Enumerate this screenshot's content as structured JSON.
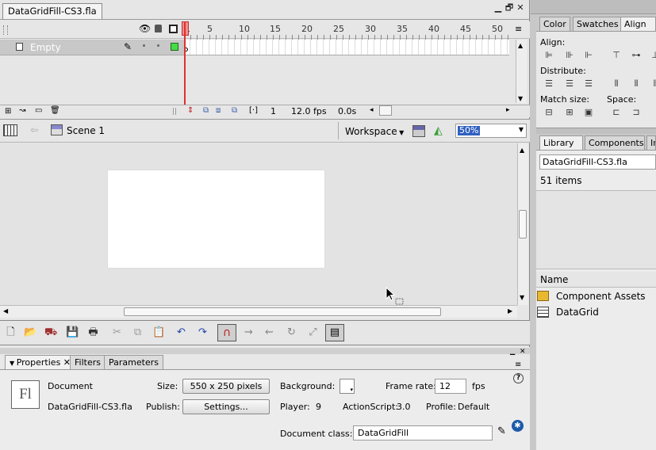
{
  "document_tab": {
    "label": "DataGridFill-CS3.fla"
  },
  "window_controls": {
    "minimize": "▁",
    "restore": "🗗",
    "close": "✕"
  },
  "timeline": {
    "ruler": [
      "1",
      "5",
      "10",
      "15",
      "20",
      "25",
      "30",
      "35",
      "40",
      "45",
      "50"
    ],
    "layer": {
      "name": "Empty"
    },
    "status": {
      "frame": "1",
      "fps": "12.0 fps",
      "time": "0.0s"
    }
  },
  "scene_bar": {
    "scene_label": "Scene 1",
    "workspace_label": "Workspace",
    "zoom_value": "50%"
  },
  "properties": {
    "tabs": [
      "Properties",
      "Filters",
      "Parameters"
    ],
    "type_label": "Document",
    "file_name": "DataGridFill-CS3.fla",
    "logo_text": "Fl",
    "size_label": "Size:",
    "size_value": "550 x 250 pixels",
    "publish_label": "Publish:",
    "settings_button": "Settings...",
    "background_label": "Background:",
    "frame_rate_label": "Frame rate:",
    "frame_rate_value": "12",
    "fps_unit": "fps",
    "player_label": "Player:",
    "player_value": "9",
    "actionscript_label": "ActionScript:",
    "actionscript_value": "3.0",
    "profile_label": "Profile:",
    "profile_value": "Default",
    "doc_class_label": "Document class:",
    "doc_class_value": "DataGridFill",
    "help_icon": "?"
  },
  "align_panel": {
    "tabs": [
      "Color",
      "Swatches",
      "Align"
    ],
    "align_label": "Align:",
    "distribute_label": "Distribute:",
    "match_size_label": "Match size:",
    "space_label": "Space:"
  },
  "library_panel": {
    "tabs": [
      "Library",
      "Components",
      "In"
    ],
    "file": "DataGridFill-CS3.fla",
    "count": "51 items",
    "name_header": "Name",
    "items": [
      {
        "name": "Component Assets",
        "icon": "folder-icon"
      },
      {
        "name": "DataGrid",
        "icon": "component-icon"
      }
    ]
  }
}
